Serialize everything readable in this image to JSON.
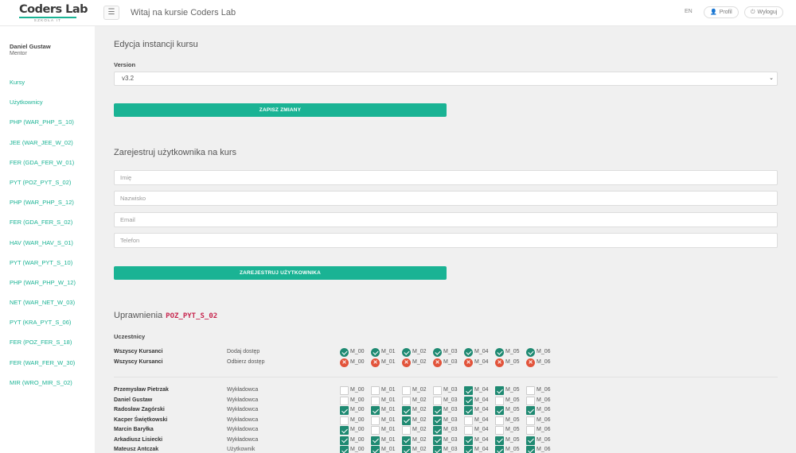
{
  "header": {
    "logo_main": "Coders Lab",
    "logo_sub": "SZKOŁA IT",
    "menu_icon": "hamburger-icon",
    "title": "Witaj na kursie Coders Lab",
    "lang": "EN",
    "profile_label": "Profil",
    "logout_label": "Wyloguj"
  },
  "sidebar": {
    "user_name": "Daniel Gustaw",
    "user_role": "Mentor",
    "items": [
      "Kursy",
      "Użytkownicy",
      "PHP (WAR_PHP_S_10)",
      "JEE (WAR_JEE_W_02)",
      "FER (GDA_FER_W_01)",
      "PYT (POZ_PYT_S_02)",
      "PHP (WAR_PHP_S_12)",
      "FER (GDA_FER_S_02)",
      "HAV (WAR_HAV_S_01)",
      "PYT (WAR_PYT_S_10)",
      "PHP (WAR_PHP_W_12)",
      "NET (WAR_NET_W_03)",
      "PYT (KRA_PYT_S_06)",
      "FER (POZ_FER_S_18)",
      "FER (WAR_FER_W_30)",
      "MIR (WRO_MIR_S_02)"
    ]
  },
  "edit": {
    "heading": "Edycja instancji kursu",
    "version_label": "Version",
    "version_value": "v3.2",
    "save_label": "ZAPISZ ZMIANY"
  },
  "register": {
    "heading": "Zarejestruj użytkownika na kurs",
    "first_name_ph": "Imię",
    "last_name_ph": "Nazwisko",
    "email_ph": "Email",
    "phone_ph": "Telefon",
    "submit_label": "ZAREJESTRUJ UŻYTKOWNIKA"
  },
  "permissions": {
    "heading": "Uprawnienia",
    "code": "POZ_PYT_S_02",
    "participants_label": "Uczestnicy",
    "modules": [
      "M_00",
      "M_01",
      "M_02",
      "M_03",
      "M_04",
      "M_05",
      "M_06"
    ],
    "bulk": [
      {
        "name": "Wszyscy Kursanci",
        "action": "Dodaj dostęp",
        "kind": "grant"
      },
      {
        "name": "Wszyscy Kursanci",
        "action": "Odbierz dostęp",
        "kind": "revoke"
      }
    ],
    "users": [
      {
        "name": "Przemysław Pietrzak",
        "role": "Wykładowca",
        "access": [
          false,
          false,
          false,
          false,
          true,
          true,
          false
        ]
      },
      {
        "name": "Daniel Gustaw",
        "role": "Wykładowca",
        "access": [
          false,
          false,
          false,
          false,
          true,
          false,
          false
        ]
      },
      {
        "name": "Radosław Zagórski",
        "role": "Wykładowca",
        "access": [
          true,
          true,
          true,
          true,
          true,
          true,
          true
        ]
      },
      {
        "name": "Kacper Świętkowski",
        "role": "Wykładowca",
        "access": [
          false,
          false,
          true,
          true,
          false,
          false,
          false
        ]
      },
      {
        "name": "Marcin Baryłka",
        "role": "Wykładowca",
        "access": [
          true,
          false,
          false,
          true,
          false,
          false,
          false
        ]
      },
      {
        "name": "Arkadiusz Lisiecki",
        "role": "Wykładowca",
        "access": [
          true,
          true,
          true,
          true,
          true,
          true,
          true
        ]
      },
      {
        "name": "Mateusz Antczak",
        "role": "Użytkownik",
        "access": [
          true,
          true,
          true,
          true,
          true,
          true,
          true
        ]
      }
    ]
  }
}
